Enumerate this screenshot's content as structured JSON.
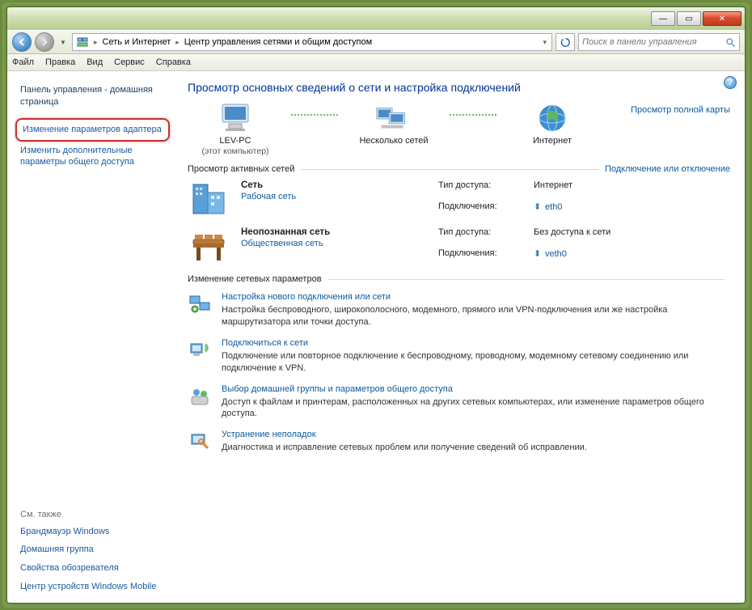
{
  "titlebar": {
    "minimize": "—",
    "maximize": "▭",
    "close": "✕"
  },
  "breadcrumb": {
    "seg1": "Сеть и Интернет",
    "seg2": "Центр управления сетями и общим доступом"
  },
  "search": {
    "placeholder": "Поиск в панели управления"
  },
  "menu": {
    "file": "Файл",
    "edit": "Правка",
    "view": "Вид",
    "service": "Сервис",
    "help": "Справка"
  },
  "sidebar": {
    "home": "Панель управления - домашняя страница",
    "adapter": "Изменение параметров адаптера",
    "sharing": "Изменить дополнительные параметры общего доступа",
    "seealso": "См. также",
    "firewall": "Брандмауэр Windows",
    "homegroup": "Домашняя группа",
    "ie": "Свойства обозревателя",
    "mobile": "Центр устройств Windows Mobile"
  },
  "main": {
    "title": "Просмотр основных сведений о сети и настройка подключений",
    "fullmap": "Просмотр полной карты",
    "map": {
      "pc": {
        "name": "LEV-PC",
        "sub": "(этот компьютер)"
      },
      "multi": {
        "name": "Несколько сетей"
      },
      "internet": {
        "name": "Интернет"
      }
    },
    "active_hdr": "Просмотр активных сетей",
    "connect_link": "Подключение или отключение",
    "net1": {
      "title": "Сеть",
      "link": "Рабочая сеть",
      "access_lbl": "Тип доступа:",
      "access_val": "Интернет",
      "conn_lbl": "Подключения:",
      "conn_val": "eth0"
    },
    "net2": {
      "title": "Неопознанная сеть",
      "link": "Общественная сеть",
      "access_lbl": "Тип доступа:",
      "access_val": "Без доступа к сети",
      "conn_lbl": "Подключения:",
      "conn_val": "veth0"
    },
    "change_hdr": "Изменение сетевых параметров",
    "s1": {
      "t": "Настройка нового подключения или сети",
      "d": "Настройка беспроводного, широкополосного, модемного, прямого или VPN-подключения или же настройка маршрутизатора или точки доступа."
    },
    "s2": {
      "t": "Подключиться к сети",
      "d": "Подключение или повторное подключение к беспроводному, проводному, модемному сетевому соединению или подключение к VPN."
    },
    "s3": {
      "t": "Выбор домашней группы и параметров общего доступа",
      "d": "Доступ к файлам и принтерам, расположенных на других сетевых компьютерах, или изменение параметров общего доступа."
    },
    "s4": {
      "t": "Устранение неполадок",
      "d": "Диагностика и исправление сетевых проблем или получение сведений об исправлении."
    }
  }
}
